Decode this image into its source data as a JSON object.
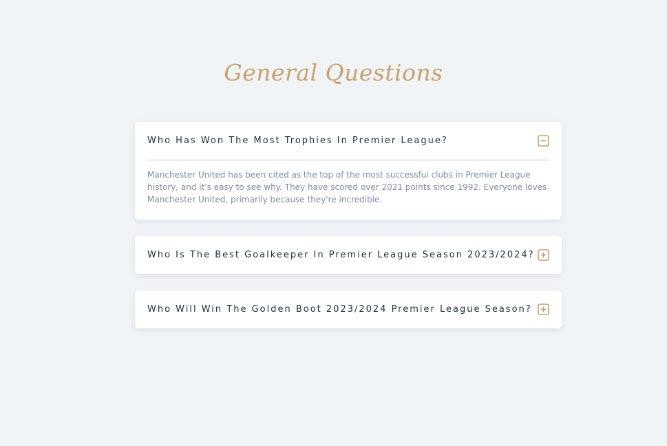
{
  "page": {
    "title": "General Questions"
  },
  "colors": {
    "background": "#f0f4f7",
    "accent": "#c9a26a",
    "question_text": "#1f2d3d",
    "answer_text": "#7a8ea3"
  },
  "faq": [
    {
      "question": "Who Has Won The Most Trophies In Premier League?",
      "answer": "Manchester United has been cited as the top of the most successful clubs in Premier League history, and it's easy to see why. They have scored over 2021 points since 1992. Everyone loves Manchester United, primarily because they're incredible.",
      "expanded": true,
      "icon": "minus-square-icon"
    },
    {
      "question": "Who Is The Best Goalkeeper In Premier League Season 2023/2024?",
      "expanded": false,
      "icon": "plus-square-icon"
    },
    {
      "question": "Who Will Win The Golden Boot 2023/2024 Premier League Season?",
      "expanded": false,
      "icon": "plus-square-icon"
    }
  ]
}
